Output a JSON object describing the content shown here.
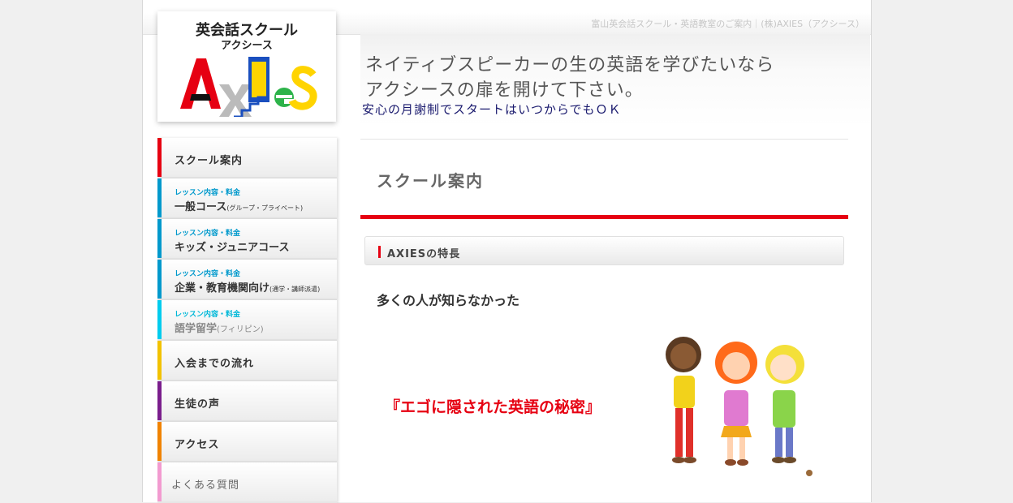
{
  "header": {
    "breadcrumb": "富山英会話スクール・英語教室のご案内｜(株)AXIES（アクシース）"
  },
  "logo": {
    "line1": "英会話スクール",
    "line2": "アクシース",
    "wordmark": "AXIES"
  },
  "hero": {
    "line1": "ネイティブスピーカーの生の英語を学びたいなら",
    "line2": "アクシースの扉を開けて下さい。",
    "sub": "安心の月謝制でスタートはいつからでもＯＫ"
  },
  "sidebar": {
    "items": [
      {
        "label": "スクール案内",
        "color": "#e60012"
      },
      {
        "tag": "レッスン内容・料金",
        "label": "一般コース",
        "note": "(グループ・プライベート)",
        "color": "#0099cc"
      },
      {
        "tag": "レッスン内容・料金",
        "label": "キッズ・ジュニアコース",
        "color": "#0099cc"
      },
      {
        "tag": "レッスン内容・料金",
        "label": "企業・教育機関向け",
        "note": "(通学・講師派遣)",
        "color": "#0099cc"
      },
      {
        "tag": "レッスン内容・料金",
        "label": "語学留学",
        "note": "(フィリピン)",
        "color": "#00ccee"
      },
      {
        "label": "入会までの流れ",
        "color": "#f2c200"
      },
      {
        "label": "生徒の声",
        "color": "#7a1e8c"
      },
      {
        "label": "アクセス",
        "color": "#f08300"
      },
      {
        "label": "よくある質問",
        "color": "#f29bd0"
      }
    ]
  },
  "main": {
    "title": "スクール案内",
    "section_heading": "AXIESの特長",
    "lead": "多くの人が知らなかった",
    "secret": "『エゴに隠された英語の秘密』"
  }
}
